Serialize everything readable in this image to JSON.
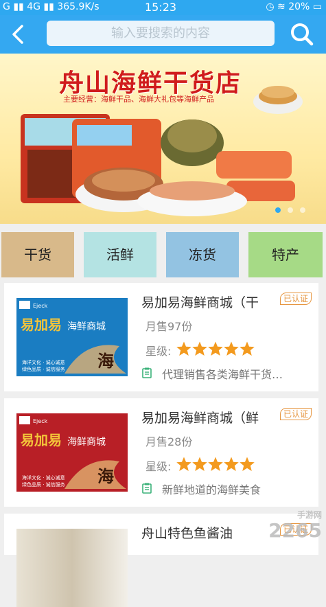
{
  "status": {
    "signal_left": "G",
    "network": "4G",
    "speed": "365.9K/s",
    "time": "15:23",
    "battery": "20%"
  },
  "search": {
    "placeholder": "输入要搜索的内容"
  },
  "banner": {
    "title": "舟山海鲜干货店",
    "subtitle": "主要经营：海鲜干品、海鲜大礼包等海鲜产品"
  },
  "categories": [
    {
      "label": "干货",
      "color": "#d8b98a"
    },
    {
      "label": "活鲜",
      "color": "#b4e3e3"
    },
    {
      "label": "冻货",
      "color": "#93c3e2"
    },
    {
      "label": "特产",
      "color": "#a6da86"
    }
  ],
  "items": [
    {
      "name": "易加易海鲜商城（干",
      "badge": "已认证",
      "sales": "月售97份",
      "stars_label": "星级:",
      "rating": 5,
      "note": "代理销售各类海鲜干货…",
      "thumb_color": "#1a7dc2",
      "thumb_text": "易加易",
      "thumb_text2": "海鲜商城"
    },
    {
      "name": "易加易海鲜商城（鲜",
      "badge": "已认证",
      "sales": "月售28份",
      "stars_label": "星级:",
      "rating": 5,
      "note": "新鲜地道的海鲜美食",
      "thumb_color": "#b81f26",
      "thumb_text": "易加易",
      "thumb_text2": "海鲜商城"
    },
    {
      "name": "舟山特色鱼酱油",
      "badge": "已认证"
    }
  ],
  "watermark": {
    "main": "2265",
    "sub": "手游网"
  }
}
